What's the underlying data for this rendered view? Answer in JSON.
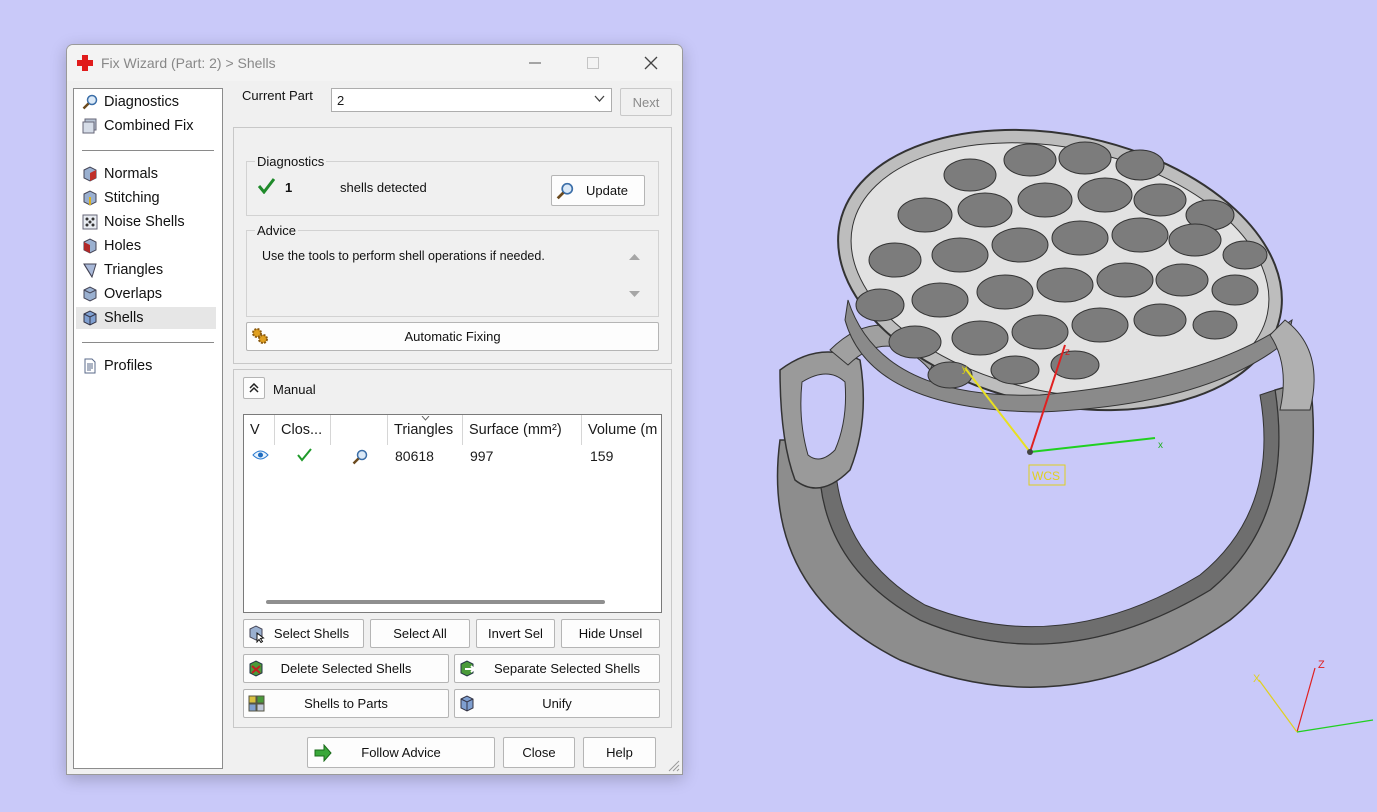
{
  "window": {
    "title": "Fix Wizard (Part: 2) > Shells"
  },
  "nav": {
    "items": [
      {
        "label": "Diagnostics"
      },
      {
        "label": "Combined Fix"
      },
      {
        "label": "Normals"
      },
      {
        "label": "Stitching"
      },
      {
        "label": "Noise Shells"
      },
      {
        "label": "Holes"
      },
      {
        "label": "Triangles"
      },
      {
        "label": "Overlaps"
      },
      {
        "label": "Shells"
      },
      {
        "label": "Profiles"
      }
    ],
    "selected": "Shells"
  },
  "current_part": {
    "label": "Current Part",
    "value": "2",
    "next_label": "Next"
  },
  "diagnostics": {
    "title": "Diagnostics",
    "count": "1",
    "text": "shells detected",
    "update_label": "Update"
  },
  "advice": {
    "title": "Advice",
    "text": "Use the tools to perform shell operations if needed."
  },
  "automatic_fixing_label": "Automatic Fixing",
  "manual": {
    "title": "Manual",
    "columns": [
      "V",
      "Clos...",
      "",
      "Triangles",
      "Surface (mm²)",
      "Volume (m"
    ],
    "row": {
      "triangles": "80618",
      "surface": "997",
      "volume": "159"
    }
  },
  "buttons": {
    "select_shells": "Select Shells",
    "select_all": "Select All",
    "invert_sel": "Invert Sel",
    "hide_unsel": "Hide Unsel",
    "delete_selected_shells": "Delete Selected Shells",
    "separate_selected_shells": "Separate Selected Shells",
    "shells_to_parts": "Shells to Parts",
    "unify": "Unify",
    "follow_advice": "Follow Advice",
    "close": "Close",
    "help": "Help"
  },
  "viewport": {
    "background": "#c9c9f9",
    "axis_labels": {
      "x": "x",
      "y": "y",
      "z": "z",
      "wcs": "WCS",
      "corner_x": "X",
      "corner_z": "Z"
    }
  }
}
